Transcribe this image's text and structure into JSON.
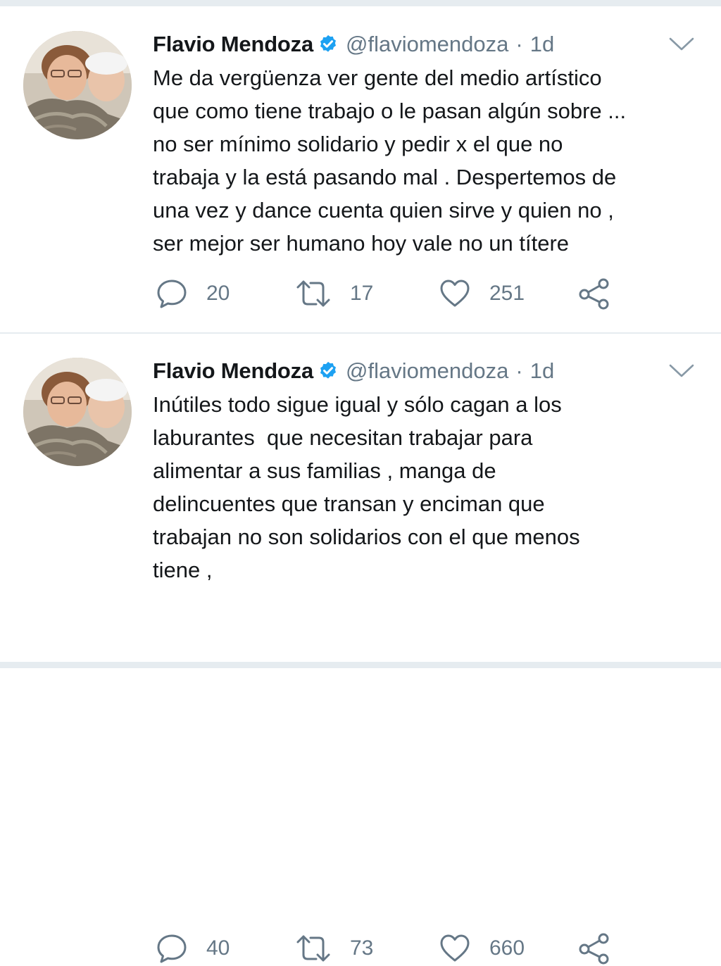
{
  "colors": {
    "text": "#14171a",
    "secondary": "#657786",
    "verified": "#1da1f2",
    "divider": "#e6ecf0"
  },
  "tweets": [
    {
      "author": {
        "name": "Flavio Mendoza",
        "handle": "@flaviomendoza",
        "verified": true,
        "avatar_icon": "profile-photo"
      },
      "separator": "·",
      "time": "1d",
      "text": "Me da vergüenza ver gente del medio artístico\nque como tiene trabajo o le pasan algún sobre ...\nno ser mínimo solidario y pedir x el que no\ntrabaja y la está pasando mal . Despertemos de\nuna vez y dance cuenta quien sirve y quien no ,\nser mejor ser humano hoy vale no un títere",
      "replies": "20",
      "retweets": "17",
      "likes": "251"
    },
    {
      "author": {
        "name": "Flavio Mendoza",
        "handle": "@flaviomendoza",
        "verified": true,
        "avatar_icon": "profile-photo"
      },
      "separator": "·",
      "time": "1d",
      "text": "Inútiles todo sigue igual y sólo cagan a los\nlaburantes  que necesitan trabajar para\nalimentar a sus familias , manga de\ndelincuentes que transan y enciman que\ntrabajan no son solidarios con el que menos\ntiene ,",
      "replies": "40",
      "retweets": "73",
      "likes": "660"
    }
  ],
  "icons": {
    "reply": "reply-icon",
    "retweet": "retweet-icon",
    "like": "heart-icon",
    "share": "share-icon",
    "menu": "chevron-down-icon",
    "verified": "verified-badge-icon"
  }
}
